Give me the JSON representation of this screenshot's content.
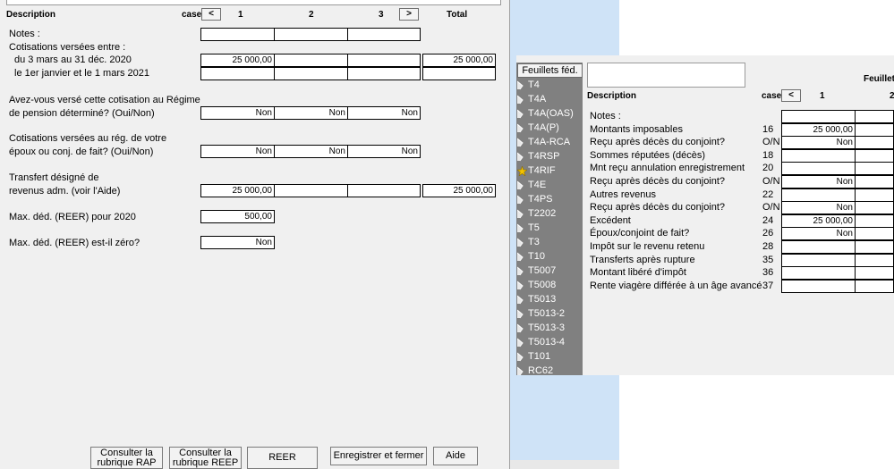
{
  "left": {
    "headers": {
      "description": "Description",
      "case": "case",
      "prev": "<",
      "col1": "1",
      "col2": "2",
      "col3": "3",
      "next": ">",
      "total": "Total"
    },
    "rows": {
      "notes": "Notes :",
      "cotisations": "Cotisations versées entre :",
      "period1": "du 3 mars au 31 déc. 2020",
      "period2": "le 1er janvier et le 1 mars 2021",
      "rpd_q1": "Avez-vous versé cette cotisation au Régime",
      "rpd_q2": "de pension déterminé? (Oui/Non)",
      "spouse_q1": "Cotisations versées au rég. de votre",
      "spouse_q2": "époux ou conj. de fait? (Oui/Non)",
      "transfer_q1": "Transfert désigné de",
      "transfer_q2": "revenus adm. (voir l'Aide)",
      "maxded": "Max. déd. (REER) pour 2020",
      "maxzero": "Max. déd. (REER) est-il zéro?"
    },
    "values": {
      "period1_c1": "25 000,00",
      "period1_total": "25 000,00",
      "rpd_c1": "Non",
      "rpd_c2": "Non",
      "rpd_c3": "Non",
      "spouse_c1": "Non",
      "spouse_c2": "Non",
      "spouse_c3": "Non",
      "transfer_c1": "25 000,00",
      "transfer_total": "25 000,00",
      "maxded": "500,00",
      "maxzero": "Non"
    },
    "buttons": {
      "rap_l1": "Consulter la",
      "rap_l2": "rubrique RAP",
      "reep_l1": "Consulter la",
      "reep_l2": "rubrique REEP",
      "reer": "REER",
      "save": "Enregistrer et fermer",
      "help": "Aide"
    }
  },
  "right": {
    "sidebar_title": "Feuillets féd.",
    "sidebar_items": [
      "T4",
      "T4A",
      "T4A(OAS)",
      "T4A(P)",
      "T4A-RCA",
      "T4RSP",
      "T4RIF",
      "T4E",
      "T4PS",
      "T2202",
      "T5",
      "T3",
      "T10",
      "T5007",
      "T5008",
      "T5013",
      "T5013-2",
      "T5013-3",
      "T5013-4",
      "T101",
      "RC62"
    ],
    "headers": {
      "feuillet": "Feuillet",
      "description": "Description",
      "case": "case",
      "prev": "<",
      "col1": "1",
      "col2": "2"
    },
    "rows": [
      {
        "label": "Notes :",
        "case": "",
        "v1": ""
      },
      {
        "label": "Montants imposables",
        "case": "16",
        "v1": "25 000,00"
      },
      {
        "label": "Reçu après décès du conjoint?",
        "case": "O/N",
        "v1": "Non"
      },
      {
        "label": "Sommes réputées (décès)",
        "case": "18",
        "v1": ""
      },
      {
        "label": "Mnt reçu annulation enregistrement",
        "case": "20",
        "v1": ""
      },
      {
        "label": "Reçu après décès du conjoint?",
        "case": "O/N",
        "v1": "Non"
      },
      {
        "label": "Autres revenus",
        "case": "22",
        "v1": ""
      },
      {
        "label": "Reçu après décès du conjoint?",
        "case": "O/N",
        "v1": "Non"
      },
      {
        "label": "Excédent",
        "case": "24",
        "v1": "25 000,00"
      },
      {
        "label": "Époux/conjoint de fait?",
        "case": "26",
        "v1": "Non"
      },
      {
        "label": "Impôt sur le revenu retenu",
        "case": "28",
        "v1": ""
      },
      {
        "label": "Transferts après rupture",
        "case": "35",
        "v1": ""
      },
      {
        "label": "Montant libéré d'impôt",
        "case": "36",
        "v1": ""
      },
      {
        "label": "Rente viagère différée à un âge avancé",
        "case": "37",
        "v1": ""
      }
    ]
  }
}
